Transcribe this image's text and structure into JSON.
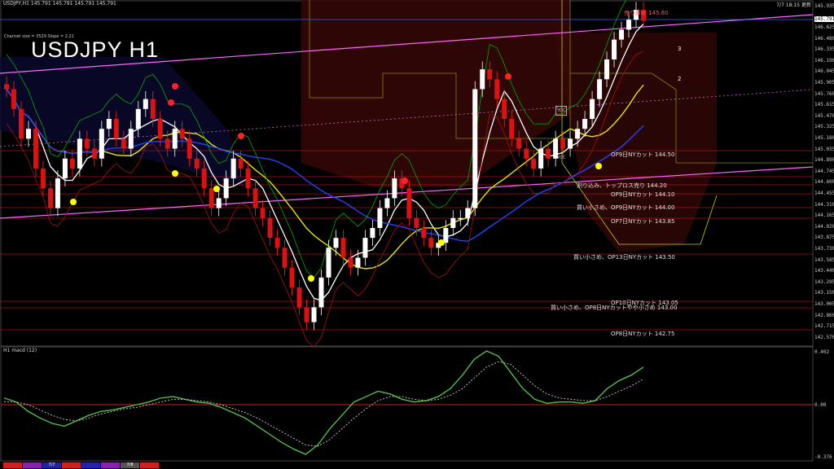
{
  "header": {
    "symbol_line": "USDJPY,H1  145.791 145.791 145.791 145.791",
    "chart_title": "USDJPY H1",
    "info_line": "Channel size = 3529  Slope = 2.21",
    "clock": "7/7 18:15 更新",
    "current_price_tag": "145.791"
  },
  "macd": {
    "label": "H1 macd (12)",
    "axis_labels": [
      "0.402",
      "0.00",
      "-0.376"
    ]
  },
  "price_axis": [
    "145.935",
    "145.791",
    "146.625",
    "146.480",
    "146.335",
    "146.190",
    "146.045",
    "145.905",
    "145.760",
    "145.615",
    "145.470",
    "145.325",
    "145.180",
    "145.035",
    "144.890",
    "144.745",
    "144.600",
    "144.455",
    "144.310",
    "144.165",
    "144.020",
    "143.875",
    "143.730",
    "143.585",
    "143.440",
    "143.295",
    "143.150",
    "143.005",
    "142.860",
    "142.715",
    "142.570"
  ],
  "annotations": [
    {
      "text": "OP9日NYカット 144.50",
      "color": "#e0e0e0"
    },
    {
      "text": "割り込み、トップロス売り 144.20",
      "color": "#e0e0e0"
    },
    {
      "text": "OP9日NYカット 144.10",
      "color": "#e0e0e0"
    },
    {
      "text": "買い小さめ、OP9日NYカット 144.00",
      "color": "#e0e0e0"
    },
    {
      "text": "OP7日NYカット 143.85",
      "color": "#e0e0e0"
    },
    {
      "text": "買い小さめ、OP13日NYカット 143.50",
      "color": "#e0e0e0"
    },
    {
      "text": "OP10日NYカット 143.05",
      "color": "#e0e0e0"
    },
    {
      "text": "買い小さめ、OP8日NYカットやや小さめ 143.00",
      "color": "#e0e0e0"
    },
    {
      "text": "OP8日NYカット 142.75",
      "color": "#e0e0e0"
    },
    {
      "text": "売り厚め 145.80",
      "color": "#ff5050"
    }
  ],
  "channel_markers": [
    "3",
    "2"
  ],
  "box_labels": [
    "YDC",
    "YDC"
  ],
  "bottom_tabs": [
    "",
    "",
    "7/7",
    "",
    "",
    "",
    "7/8",
    ""
  ],
  "chart_data": {
    "type": "candlestick",
    "title": "USDJPY H1",
    "ylim": [
      142.55,
      145.95
    ],
    "closes": [
      145.1,
      144.9,
      144.6,
      144.7,
      144.3,
      144.1,
      143.9,
      144.2,
      144.4,
      144.3,
      144.6,
      144.5,
      144.4,
      144.7,
      144.8,
      144.6,
      144.5,
      144.7,
      144.9,
      145.0,
      144.8,
      144.6,
      144.5,
      144.7,
      144.6,
      144.4,
      144.3,
      144.1,
      143.9,
      144.0,
      144.2,
      144.4,
      144.3,
      144.1,
      143.9,
      143.8,
      143.6,
      143.5,
      143.3,
      143.1,
      142.9,
      142.75,
      142.9,
      143.2,
      143.5,
      143.6,
      143.4,
      143.3,
      143.4,
      143.6,
      143.7,
      143.9,
      144.0,
      144.2,
      144.1,
      143.8,
      143.7,
      143.6,
      143.5,
      143.55,
      143.7,
      143.8,
      143.8,
      143.9,
      145.1,
      145.3,
      145.2,
      145.0,
      144.8,
      144.6,
      144.5,
      144.4,
      144.3,
      144.5,
      144.4,
      144.6,
      144.5,
      144.6,
      144.7,
      144.8,
      145.0,
      145.2,
      145.4,
      145.6,
      145.7,
      145.8,
      145.9,
      145.79
    ],
    "macd": [
      0.05,
      0.02,
      -0.05,
      -0.1,
      -0.14,
      -0.16,
      -0.12,
      -0.08,
      -0.05,
      -0.04,
      -0.02,
      0.0,
      0.02,
      0.05,
      0.06,
      0.04,
      0.02,
      0.01,
      -0.02,
      -0.06,
      -0.1,
      -0.16,
      -0.22,
      -0.28,
      -0.33,
      -0.37,
      -0.3,
      -0.18,
      -0.08,
      0.02,
      0.06,
      0.1,
      0.08,
      0.04,
      0.02,
      0.03,
      0.06,
      0.12,
      0.22,
      0.34,
      0.4,
      0.36,
      0.24,
      0.12,
      0.04,
      0.01,
      0.02,
      0.02,
      0.01,
      0.03,
      0.12,
      0.18,
      0.22,
      0.28
    ],
    "signal": [
      0.02,
      0.02,
      0.0,
      -0.04,
      -0.08,
      -0.11,
      -0.12,
      -0.1,
      -0.07,
      -0.05,
      -0.03,
      -0.02,
      0.0,
      0.02,
      0.04,
      0.04,
      0.03,
      0.02,
      0.0,
      -0.03,
      -0.06,
      -0.1,
      -0.15,
      -0.2,
      -0.25,
      -0.3,
      -0.31,
      -0.26,
      -0.18,
      -0.1,
      -0.03,
      0.03,
      0.06,
      0.06,
      0.04,
      0.03,
      0.04,
      0.07,
      0.12,
      0.2,
      0.28,
      0.32,
      0.3,
      0.22,
      0.14,
      0.08,
      0.05,
      0.04,
      0.03,
      0.03,
      0.06,
      0.1,
      0.14,
      0.19
    ]
  }
}
